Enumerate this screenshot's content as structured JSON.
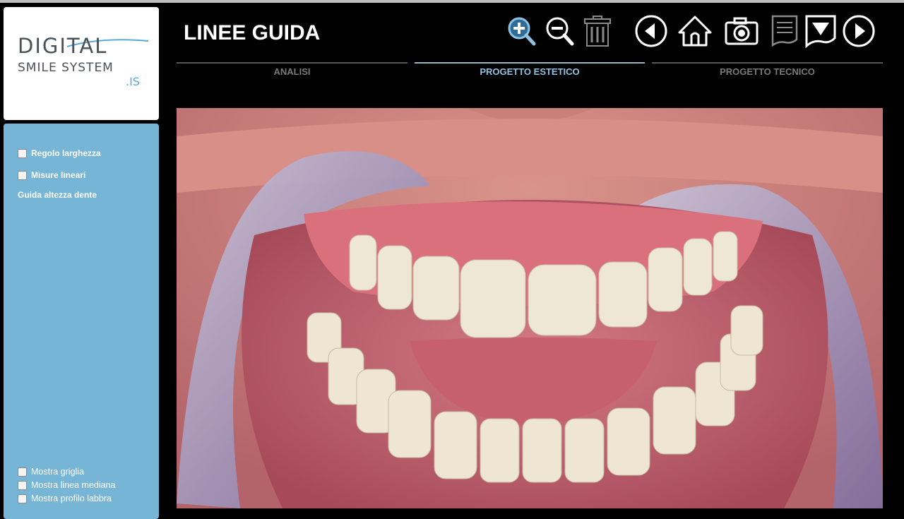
{
  "app": {
    "logo_main": "DIGITAL",
    "logo_sub": "SMILE SYSTEM",
    "logo_suffix": ".IS"
  },
  "header": {
    "title": "LINEE GUIDA"
  },
  "toolbar": [
    {
      "name": "zoom-in-icon",
      "active": true
    },
    {
      "name": "zoom-out-icon",
      "active": false
    },
    {
      "name": "trash-icon",
      "active": false
    },
    {
      "name": "back-arrow-icon",
      "active": false
    },
    {
      "name": "home-icon",
      "active": false
    },
    {
      "name": "camera-icon",
      "active": false
    },
    {
      "name": "notes-icon",
      "active": false
    },
    {
      "name": "export-icon",
      "active": false
    },
    {
      "name": "forward-arrow-icon",
      "active": false
    }
  ],
  "tabs": [
    {
      "label": "ANALISI",
      "active": false
    },
    {
      "label": "PROGETTO ESTETICO",
      "active": true
    },
    {
      "label": "PROGETTO TECNICO",
      "active": false
    }
  ],
  "sidebar": {
    "options_top": [
      {
        "label": "Regolo larghezza",
        "checked": false
      },
      {
        "label": "Misure lineari",
        "checked": false
      }
    ],
    "guide_label": "Guida altezza dente",
    "options_bottom": [
      {
        "label": "Mostra griglia",
        "checked": false
      },
      {
        "label": "Mostra linea mediana",
        "checked": false
      },
      {
        "label": "Mostra profilo labbra",
        "checked": false
      }
    ]
  },
  "colors": {
    "sidebar": "#77b5d6",
    "accent": "#8fc3e3",
    "background": "#000000"
  }
}
